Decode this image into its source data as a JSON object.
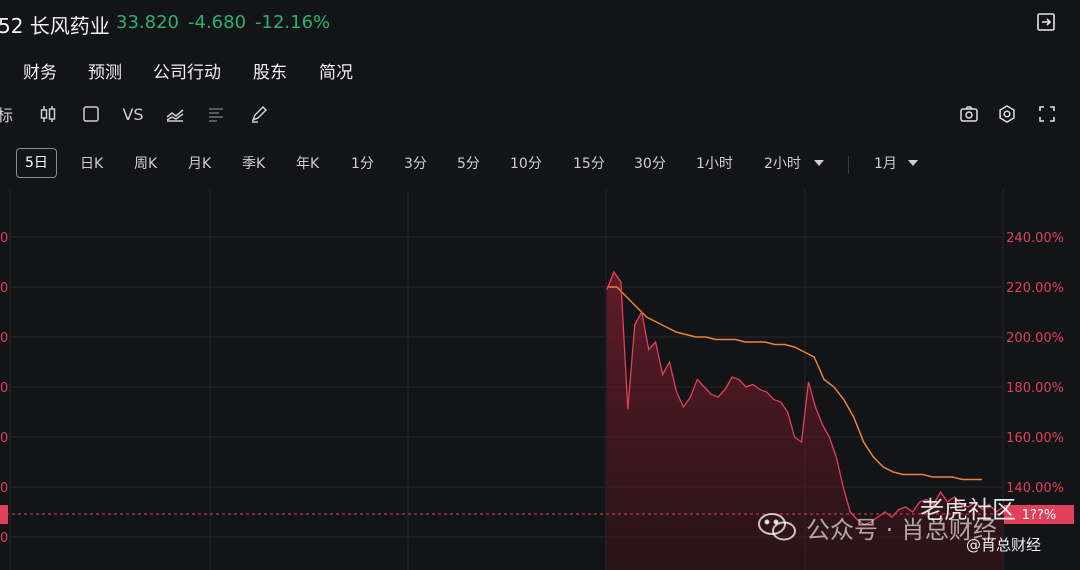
{
  "header": {
    "title": "52 长风药业",
    "price": "33.820",
    "change": "-4.680",
    "change_pct": "-12.16%",
    "quote_color": "#26b36b"
  },
  "tabs": [
    "财务",
    "预测",
    "公司行动",
    "股东",
    "简况"
  ],
  "toolbar": {
    "indicator_label": "标",
    "vs_label": "VS",
    "icons": [
      "candlestick-icon",
      "square-icon",
      "compare-text",
      "chart-line-icon",
      "list-icon",
      "pen-icon",
      "camera-icon",
      "settings-icon",
      "fullscreen-icon"
    ]
  },
  "periods": {
    "items": [
      "5日",
      "日K",
      "周K",
      "月K",
      "季K",
      "年K",
      "1分",
      "3分",
      "5分",
      "10分",
      "15分",
      "30分",
      "1小时",
      "2小时",
      "1月"
    ],
    "active": "5日"
  },
  "chart_data": {
    "type": "line",
    "y_right_ticks": [
      "240.00%",
      "220.00%",
      "200.00%",
      "180.00%",
      "160.00%",
      "140.00%"
    ],
    "y_left_ticks": [
      "0",
      "0",
      "0",
      "0",
      "0",
      "0",
      "0",
      "0"
    ],
    "current_label": "1??%",
    "colors": {
      "price": "#e0405a",
      "avg": "#e8843a",
      "axis_text": "#e0405a"
    },
    "ylim": [
      110,
      255
    ],
    "series": [
      {
        "values": [
          219,
          226,
          222,
          171,
          205,
          210,
          195,
          198,
          185,
          190,
          178,
          172,
          176,
          183,
          180,
          177,
          176,
          179,
          184,
          183,
          180,
          181,
          179,
          178,
          175,
          174,
          170,
          160,
          158,
          182,
          172,
          165,
          160,
          152,
          140,
          130,
          127,
          125,
          126,
          128,
          130,
          128,
          131,
          132,
          130,
          134,
          135,
          133,
          138,
          134,
          136,
          133,
          132,
          134,
          131,
          133,
          130,
          132
        ]
      },
      {
        "values": [
          220,
          220,
          216,
          212,
          208,
          206,
          204,
          202,
          201,
          200,
          200,
          199,
          199,
          199,
          198,
          198,
          198,
          197,
          197,
          196,
          194,
          192,
          183,
          180,
          175,
          168,
          158,
          152,
          148,
          146,
          145,
          145,
          145,
          144,
          144,
          144,
          143,
          143,
          143
        ]
      }
    ]
  },
  "watermark": {
    "site": "老虎社区",
    "wechat": "公众号 · 肖总财经",
    "handle": "@肖总财经"
  }
}
